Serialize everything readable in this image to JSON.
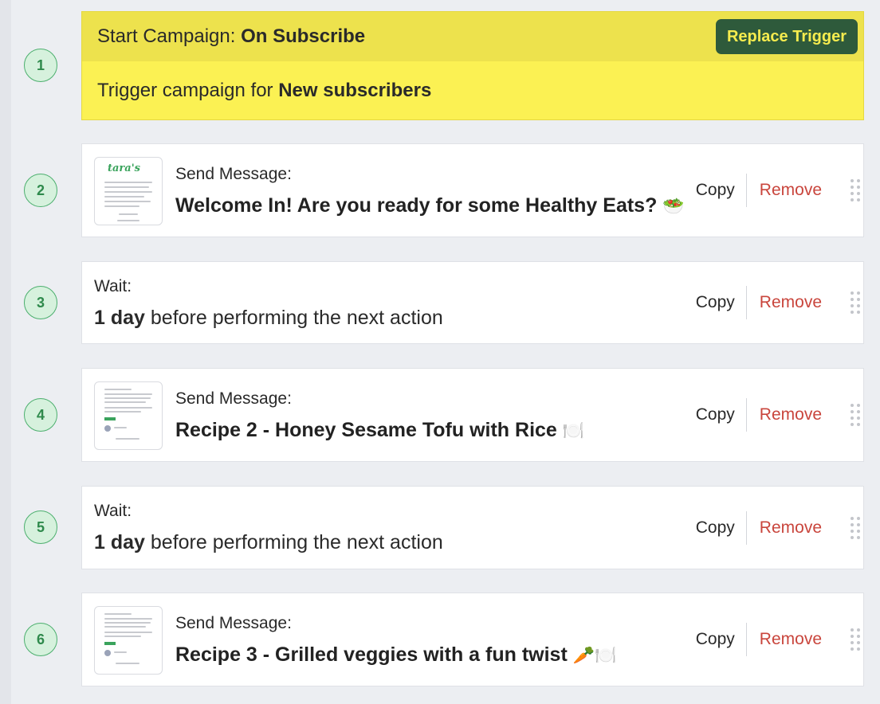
{
  "trigger": {
    "step": "1",
    "prefix": "Start Campaign: ",
    "name": "On Subscribe",
    "replace_label": "Replace Trigger",
    "body_prefix": "Trigger campaign for ",
    "body_value": "New subscribers"
  },
  "steps": [
    {
      "step": "2",
      "type": "Send Message:",
      "title": "Welcome In! Are you ready for some Healthy Eats?",
      "emoji": "🥗",
      "copy": "Copy",
      "remove": "Remove"
    },
    {
      "step": "3",
      "type": "Wait:",
      "duration": "1 day",
      "rest": " before performing the next action",
      "copy": "Copy",
      "remove": "Remove"
    },
    {
      "step": "4",
      "type": "Send Message:",
      "title": "Recipe 2 - Honey Sesame Tofu with Rice",
      "emoji": "🍽️",
      "copy": "Copy",
      "remove": "Remove"
    },
    {
      "step": "5",
      "type": "Wait:",
      "duration": "1 day",
      "rest": " before performing the next action",
      "copy": "Copy",
      "remove": "Remove"
    },
    {
      "step": "6",
      "type": "Send Message:",
      "title": "Recipe 3 - Grilled veggies with a fun twist",
      "emoji": "🥕🍽️",
      "copy": "Copy",
      "remove": "Remove"
    }
  ],
  "colors": {
    "trigger_bg": "#fbf153",
    "accent_green": "#2e5a3b",
    "remove_red": "#c9453c"
  }
}
